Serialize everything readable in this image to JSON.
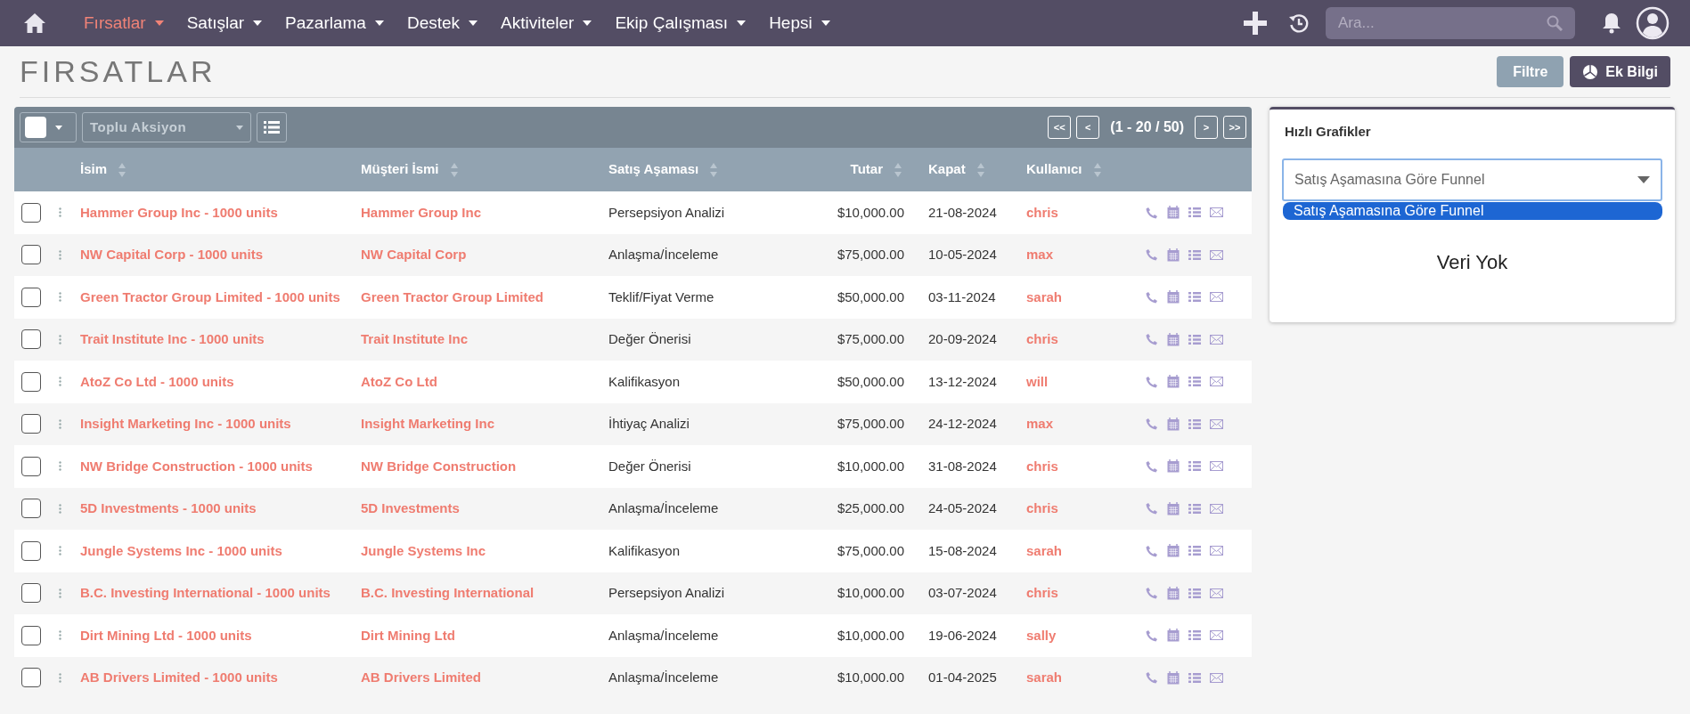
{
  "nav": {
    "items": [
      {
        "label": "Fırsatlar",
        "selected": true
      },
      {
        "label": "Satışlar",
        "selected": false
      },
      {
        "label": "Pazarlama",
        "selected": false
      },
      {
        "label": "Destek",
        "selected": false
      },
      {
        "label": "Aktiviteler",
        "selected": false
      },
      {
        "label": "Ekip Çalışması",
        "selected": false
      },
      {
        "label": "Hepsi",
        "selected": false
      }
    ],
    "search": {
      "placeholder": "Ara..."
    }
  },
  "page": {
    "title": "FIRSATLAR",
    "buttons": [
      {
        "label": "Filtre",
        "kind": "secondary"
      },
      {
        "label": "Ek Bilgi",
        "kind": "primary"
      }
    ]
  },
  "list": {
    "toolbar": {
      "select_all": {
        "checked": false
      },
      "bulk_action": "Toplu Aksiyon",
      "pagination": {
        "first": "<<",
        "prev": "<",
        "range": "(1 - 20 / 50)",
        "next": ">",
        "last": ">>"
      }
    },
    "columns": [
      "İsim",
      "Müşteri İsmi",
      "Satış Aşaması",
      "Tutar",
      "Kapat",
      "Kullanıcı"
    ],
    "rows": [
      {
        "checked": false,
        "name": "Hammer Group Inc - 1000 units",
        "account": "Hammer Group Inc",
        "stage": "Persepsiyon Analizi",
        "amount": "$10,000.00",
        "close": "21-08-2024",
        "user": "chris"
      },
      {
        "checked": false,
        "name": "NW Capital Corp - 1000 units",
        "account": "NW Capital Corp",
        "stage": "Anlaşma/İnceleme",
        "amount": "$75,000.00",
        "close": "10-05-2024",
        "user": "max"
      },
      {
        "checked": false,
        "name": "Green Tractor Group Limited - 1000 units",
        "account": "Green Tractor Group Limited",
        "stage": "Teklif/Fiyat Verme",
        "amount": "$50,000.00",
        "close": "03-11-2024",
        "user": "sarah"
      },
      {
        "checked": false,
        "name": "Trait Institute Inc - 1000 units",
        "account": "Trait Institute Inc",
        "stage": "Değer Önerisi",
        "amount": "$75,000.00",
        "close": "20-09-2024",
        "user": "chris"
      },
      {
        "checked": false,
        "name": "AtoZ Co Ltd - 1000 units",
        "account": "AtoZ Co Ltd",
        "stage": "Kalifikasyon",
        "amount": "$50,000.00",
        "close": "13-12-2024",
        "user": "will"
      },
      {
        "checked": false,
        "name": "Insight Marketing Inc - 1000 units",
        "account": "Insight Marketing Inc",
        "stage": "İhtiyaç Analizi",
        "amount": "$75,000.00",
        "close": "24-12-2024",
        "user": "max"
      },
      {
        "checked": false,
        "name": "NW Bridge Construction - 1000 units",
        "account": "NW Bridge Construction",
        "stage": "Değer Önerisi",
        "amount": "$10,000.00",
        "close": "31-08-2024",
        "user": "chris"
      },
      {
        "checked": false,
        "name": "5D Investments - 1000 units",
        "account": "5D Investments",
        "stage": "Anlaşma/İnceleme",
        "amount": "$25,000.00",
        "close": "24-05-2024",
        "user": "chris"
      },
      {
        "checked": false,
        "name": "Jungle Systems Inc - 1000 units",
        "account": "Jungle Systems Inc",
        "stage": "Kalifikasyon",
        "amount": "$75,000.00",
        "close": "15-08-2024",
        "user": "sarah"
      },
      {
        "checked": false,
        "name": "B.C. Investing International - 1000 units",
        "account": "B.C. Investing International",
        "stage": "Persepsiyon Analizi",
        "amount": "$10,000.00",
        "close": "03-07-2024",
        "user": "chris"
      },
      {
        "checked": false,
        "name": "Dirt Mining Ltd - 1000 units",
        "account": "Dirt Mining Ltd",
        "stage": "Anlaşma/İnceleme",
        "amount": "$10,000.00",
        "close": "19-06-2024",
        "user": "sally"
      },
      {
        "checked": false,
        "name": "AB Drivers Limited - 1000 units",
        "account": "AB Drivers Limited",
        "stage": "Anlaşma/İnceleme",
        "amount": "$10,000.00",
        "close": "01-04-2025",
        "user": "sarah"
      }
    ]
  },
  "quick_charts": {
    "title": "Hızlı Grafikler",
    "select": {
      "value": "Satış Aşamasına Göre Funnel",
      "expanded": true
    },
    "options": [
      {
        "label": "Satış Aşamasına Göre Funnel",
        "selected": true
      }
    ],
    "empty_text": "Veri Yok"
  }
}
